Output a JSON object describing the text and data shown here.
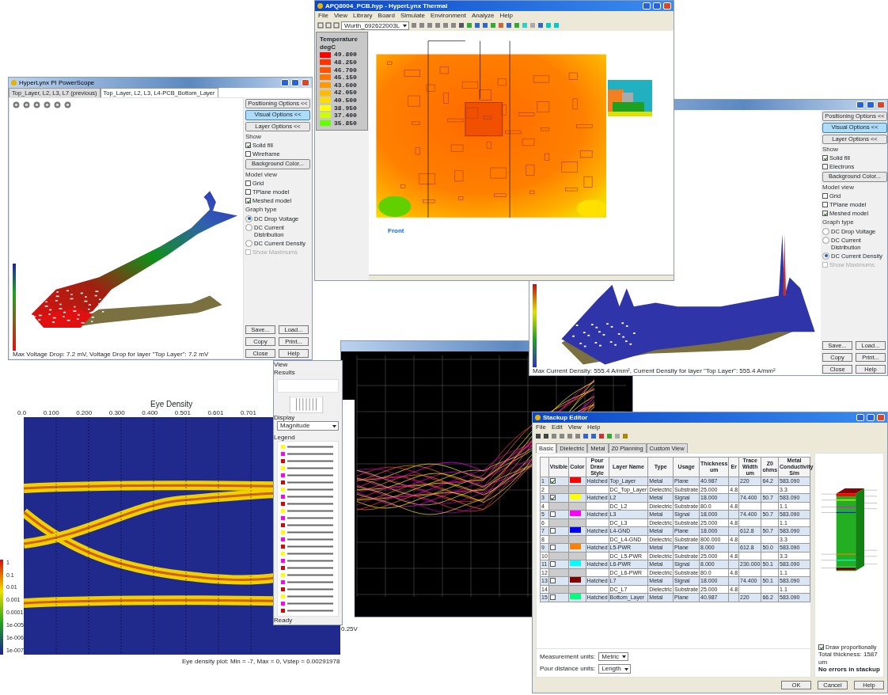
{
  "current_density_window": {
    "panel": {
      "buttons": [
        {
          "label": "Positioning Options <<",
          "selected": false
        },
        {
          "label": "Visual Options <<",
          "selected": true
        },
        {
          "label": "Layer Options <<",
          "selected": false
        }
      ],
      "groups": [
        {
          "title": "Show",
          "items": [
            {
              "kind": "check",
              "label": "Solid fill",
              "checked": true,
              "disabled": false
            },
            {
              "kind": "check",
              "label": "Electrons",
              "checked": false,
              "disabled": false
            },
            {
              "kind": "button",
              "label": "Background Color..."
            }
          ]
        },
        {
          "title": "Model view",
          "items": [
            {
              "kind": "check",
              "label": "Grid",
              "checked": false,
              "disabled": false
            },
            {
              "kind": "check",
              "label": "TPlane model",
              "checked": false,
              "disabled": false
            },
            {
              "kind": "check",
              "label": "Meshed model",
              "checked": true,
              "disabled": false
            }
          ]
        },
        {
          "title": "Graph type",
          "items": [
            {
              "kind": "radio",
              "label": "DC Drop Voltage",
              "selected": false
            },
            {
              "kind": "radio",
              "label": "DC Current Distribution",
              "selected": false
            },
            {
              "kind": "radio",
              "label": "DC Current Density",
              "selected": true
            },
            {
              "kind": "check",
              "label": "Show Maximums",
              "checked": false,
              "disabled": true
            }
          ]
        }
      ],
      "actions": [
        "Save...",
        "Load...",
        "Copy",
        "Print...",
        "Close",
        "Help"
      ]
    },
    "status": "Max Current Density: 555.4 A/mm², Current Density for layer \"Top Layer\": 555.4 A/mm²"
  },
  "thermal_window": {
    "title": "APQ8004_PCB.hyp - HyperLynx Thermal",
    "menu": [
      "File",
      "View",
      "Library",
      "Board",
      "Simulate",
      "Environment",
      "Analyze",
      "Help"
    ],
    "device": "Wurth_692622003L",
    "legend": {
      "title": "Temperature",
      "unit": "degC",
      "entries": [
        {
          "value": "49.800",
          "color": "#ff0000"
        },
        {
          "value": "48.250",
          "color": "#ff3300"
        },
        {
          "value": "46.700",
          "color": "#ff5500"
        },
        {
          "value": "45.150",
          "color": "#ff7700"
        },
        {
          "value": "43.600",
          "color": "#ff9900"
        },
        {
          "value": "42.050",
          "color": "#ffbb00"
        },
        {
          "value": "40.500",
          "color": "#ffdd00"
        },
        {
          "value": "38.950",
          "color": "#ffff00"
        },
        {
          "value": "37.400",
          "color": "#ccff00"
        },
        {
          "value": "35.850",
          "color": "#66ff00"
        }
      ]
    },
    "axis_label": "Front"
  },
  "powerscope_window": {
    "title": "HyperLynx PI PowerScope",
    "tabs": [
      {
        "label": "Top_Layer, L2, L3, L7 (previous)",
        "selected": false
      },
      {
        "label": "Top_Layer, L2, L3, L4-PCB_Bottom_Layer",
        "selected": true
      }
    ],
    "panel": {
      "buttons": [
        {
          "label": "Positioning Options <<",
          "selected": false
        },
        {
          "label": "Visual Options <<",
          "selected": true
        },
        {
          "label": "Layer Options <<",
          "selected": false
        }
      ],
      "groups": [
        {
          "title": "Show",
          "items": [
            {
              "kind": "check",
              "label": "Solid fill",
              "checked": true,
              "disabled": false
            },
            {
              "kind": "check",
              "label": "Wireframe",
              "checked": false,
              "disabled": false
            },
            {
              "kind": "button",
              "label": "Background Color..."
            }
          ]
        },
        {
          "title": "Model view",
          "items": [
            {
              "kind": "check",
              "label": "Grid",
              "checked": false,
              "disabled": false
            },
            {
              "kind": "check",
              "label": "TPlane model",
              "checked": false,
              "disabled": false
            },
            {
              "kind": "check",
              "label": "Meshed model",
              "checked": true,
              "disabled": false
            }
          ]
        },
        {
          "title": "Graph type",
          "items": [
            {
              "kind": "radio",
              "label": "DC Drop Voltage",
              "selected": true
            },
            {
              "kind": "radio",
              "label": "DC Current Distribution",
              "selected": false
            },
            {
              "kind": "radio",
              "label": "DC Current Density",
              "selected": false
            },
            {
              "kind": "check",
              "label": "Show Maximums",
              "checked": false,
              "disabled": true
            }
          ]
        }
      ],
      "actions": [
        "Save...",
        "Load...",
        "Copy",
        "Print...",
        "Close",
        "Help"
      ]
    },
    "status": "Max Voltage Drop: 7.2 mV, Voltage Drop for layer \"Top Layer\": 7.2 mV"
  },
  "eye_density": {
    "title": "Eye Density",
    "x_ticks": [
      "0.0",
      "0.100",
      "0.200",
      "0.300",
      "0.400",
      "0.501",
      "0.601",
      "0.701"
    ],
    "scale": [
      "1",
      "0.1",
      "0.01",
      "0.001",
      "0.0001",
      "1e-005",
      "1e-006",
      "1e-007"
    ],
    "right_label": "0.25V",
    "footer": "Eye density plot: Min = -7, Max = 0, Vstep = 0.00291978"
  },
  "results_panel": {
    "view_label": "View",
    "results_label": "Results",
    "display_label": "Display",
    "display_value": "Magnitude",
    "legend_label": "Legend",
    "status": "Ready"
  },
  "stackup_editor": {
    "title": "Stackup Editor",
    "menu": [
      "File",
      "Edit",
      "View",
      "Help"
    ],
    "tabs": [
      {
        "label": "Basic",
        "selected": true
      },
      {
        "label": "Dielectric",
        "selected": false
      },
      {
        "label": "Metal",
        "selected": false
      },
      {
        "label": "Z0 Planning",
        "selected": false
      },
      {
        "label": "Custom View",
        "selected": false
      }
    ],
    "columns": [
      "",
      "Visible",
      "Color",
      "Pour Draw Style",
      "Layer Name",
      "Type",
      "Usage",
      "Thickness um",
      "Er",
      "Trace Width um",
      "Z0 ohms",
      "Metal Conductivity S/m"
    ],
    "rows": [
      {
        "kind": "metal",
        "visible": true,
        "color": "#ff0000",
        "cells": [
          "1",
          "",
          "",
          "Hatched",
          "Top_Layer",
          "Metal",
          "Plane",
          "40.987",
          "",
          "220",
          "64.2",
          "583.090"
        ]
      },
      {
        "kind": "dielectric",
        "cells": [
          "2",
          "",
          "",
          "",
          "DC_Top_Layer",
          "Dielectric",
          "Substrate",
          "25.000",
          "4.8",
          "",
          "",
          "3.3"
        ]
      },
      {
        "kind": "metal",
        "visible": true,
        "color": "#ffff00",
        "cells": [
          "3",
          "",
          "",
          "Hatched",
          "L2",
          "Metal",
          "Signal",
          "18.000",
          "",
          "74.400",
          "50.7",
          "583.090"
        ]
      },
      {
        "kind": "dielectric",
        "cells": [
          "4",
          "",
          "",
          "",
          "DC_L2",
          "Dielectric",
          "Substrate",
          "80.0",
          "4.8",
          "",
          "",
          "1.1"
        ]
      },
      {
        "kind": "metal",
        "visible": false,
        "color": "#ff00ff",
        "cells": [
          "5",
          "",
          "",
          "Hatched",
          "L3",
          "Metal",
          "Signal",
          "18.000",
          "",
          "74.400",
          "50.7",
          "583.090"
        ]
      },
      {
        "kind": "dielectric",
        "cells": [
          "6",
          "",
          "",
          "",
          "DC_L3",
          "Dielectric",
          "Substrate",
          "25.000",
          "4.8",
          "",
          "",
          "1.1"
        ]
      },
      {
        "kind": "metal",
        "visible": false,
        "color": "#0000ff",
        "cells": [
          "7",
          "",
          "",
          "Hatched",
          "L4-GND",
          "Metal",
          "Plane",
          "18.000",
          "",
          "612.8",
          "50.7",
          "583.090"
        ]
      },
      {
        "kind": "dielectric",
        "cells": [
          "8",
          "",
          "",
          "",
          "DC_L4-GND",
          "Dielectric",
          "Substrate",
          "800.000",
          "4.8",
          "",
          "",
          "3.3"
        ]
      },
      {
        "kind": "metal",
        "visible": false,
        "color": "#ff8000",
        "cells": [
          "9",
          "",
          "",
          "Hatched",
          "L5-PWR",
          "Metal",
          "Plane",
          "8.000",
          "",
          "612.8",
          "50.0",
          "583.090"
        ]
      },
      {
        "kind": "dielectric",
        "cells": [
          "10",
          "",
          "",
          "",
          "DC_L5-PWR",
          "Dielectric",
          "Substrate",
          "25.000",
          "4.8",
          "",
          "",
          "3.3"
        ]
      },
      {
        "kind": "metal",
        "visible": false,
        "color": "#00ffff",
        "cells": [
          "11",
          "",
          "",
          "Hatched",
          "L6-PWR",
          "Metal",
          "Signal",
          "8.000",
          "",
          "230.000",
          "50.1",
          "583.090"
        ]
      },
      {
        "kind": "dielectric",
        "cells": [
          "12",
          "",
          "",
          "",
          "DC_L6-PWR",
          "Dielectric",
          "Substrate",
          "80.0",
          "4.8",
          "",
          "",
          "1.1"
        ]
      },
      {
        "kind": "metal",
        "visible": false,
        "color": "#800000",
        "cells": [
          "13",
          "",
          "",
          "Hatched",
          "L7",
          "Metal",
          "Signal",
          "18.000",
          "",
          "74.400",
          "50.1",
          "583.090"
        ]
      },
      {
        "kind": "dielectric",
        "cells": [
          "14",
          "",
          "",
          "",
          "DC_L7",
          "Dielectric",
          "Substrate",
          "25.000",
          "4.8",
          "",
          "",
          "1.1"
        ]
      },
      {
        "kind": "metal",
        "visible": false,
        "color": "#00ff80",
        "cells": [
          "15",
          "",
          "",
          "Hatched",
          "Bottom_Layer",
          "Metal",
          "Plane",
          "40.987",
          "",
          "220",
          "66.2",
          "583.090"
        ]
      }
    ],
    "units": [
      {
        "label": "Measurement units:",
        "value": "Metric"
      },
      {
        "label": "Pour distance units:",
        "value": "Length"
      }
    ],
    "draw_proportionally": {
      "label": "Draw proportionally",
      "checked": true
    },
    "total": "Total thickness: 1587 um",
    "errors": "No errors in stackup",
    "buttons": [
      "OK",
      "Cancel",
      "Help"
    ]
  }
}
